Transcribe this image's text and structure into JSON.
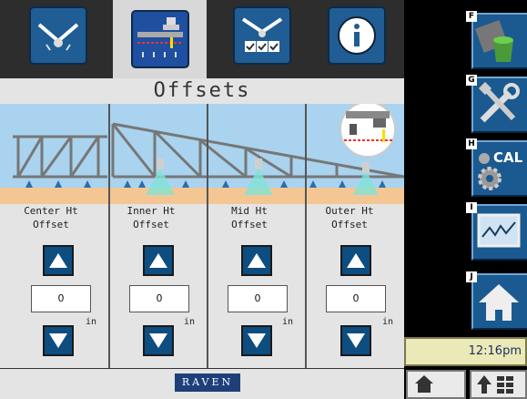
{
  "tabs": [
    {
      "name": "booms-icon",
      "active": false
    },
    {
      "name": "boom-height-offset-icon",
      "active": true
    },
    {
      "name": "boom-settings-check-icon",
      "active": false
    },
    {
      "name": "info-icon",
      "active": false
    }
  ],
  "title": "Offsets",
  "columns": [
    {
      "label_line1": "Center Ht",
      "label_line2": "Offset",
      "value": "0",
      "unit": "in"
    },
    {
      "label_line1": "Inner Ht",
      "label_line2": "Offset",
      "value": "0",
      "unit": "in"
    },
    {
      "label_line1": "Mid Ht",
      "label_line2": "Offset",
      "value": "0",
      "unit": "in"
    },
    {
      "label_line1": "Outer Ht",
      "label_line2": "Offset",
      "value": "0",
      "unit": "in"
    }
  ],
  "footer": {
    "logo": "RAVEN"
  },
  "side_buttons": [
    {
      "key": "F",
      "name": "paint-bucket-icon"
    },
    {
      "key": "G",
      "name": "tools-icon"
    },
    {
      "key": "H",
      "name": "calibration-gears-icon",
      "text": "CAL"
    },
    {
      "key": "I",
      "name": "graph-monitor-icon"
    },
    {
      "key": "J",
      "name": "home-icon"
    }
  ],
  "clock": "12:16pm",
  "colors": {
    "button_blue": "#1a5a90",
    "arrow_blue": "#0d4d80",
    "sky": "#a9d3ef",
    "ground": "#f3c693"
  }
}
